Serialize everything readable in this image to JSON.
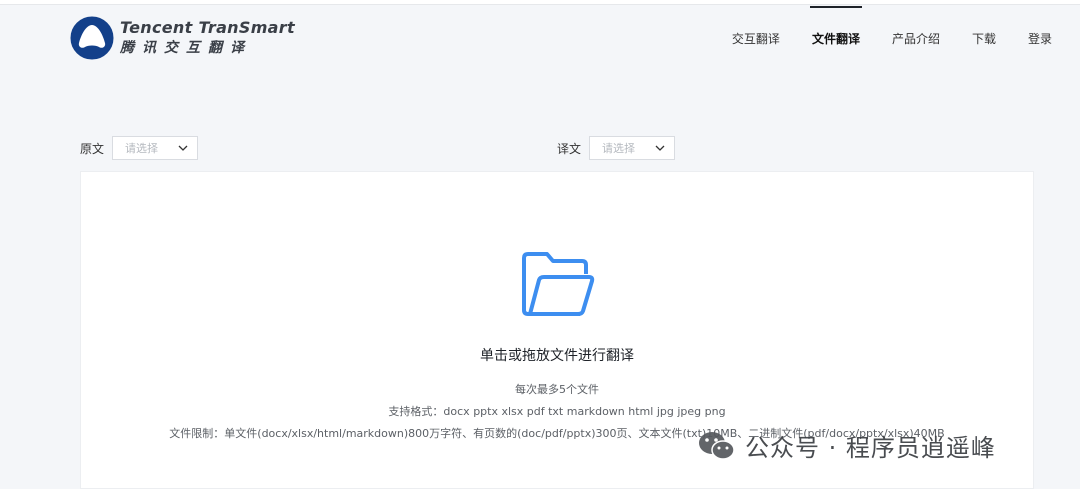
{
  "header": {
    "logo_en": "Tencent TranSmart",
    "logo_cn": "腾讯交互翻译",
    "nav": [
      {
        "label": "交互翻译",
        "active": false
      },
      {
        "label": "文件翻译",
        "active": true
      },
      {
        "label": "产品介绍",
        "active": false
      },
      {
        "label": "下载",
        "active": false
      },
      {
        "label": "登录",
        "active": false
      }
    ]
  },
  "source": {
    "label": "原文",
    "placeholder": "请选择"
  },
  "target": {
    "label": "译文",
    "placeholder": "请选择"
  },
  "upload": {
    "icon": "folder-open-icon",
    "title": "单击或拖放文件进行翻译",
    "hint_count": "每次最多5个文件",
    "hint_formats": "支持格式：docx pptx xlsx pdf txt markdown html jpg jpeg png",
    "hint_limits": "文件限制：单文件(docx/xlsx/html/markdown)800万字符、有页数的(doc/pdf/pptx)300页、文本文件(txt)10MB、二进制文件(pdf/docx/pptx/xlsx)40MB"
  },
  "watermark": {
    "text": "公众号 · 程序员逍遥峰"
  },
  "colors": {
    "accent": "#3d8ef0",
    "logo_navy": "#13408a"
  }
}
